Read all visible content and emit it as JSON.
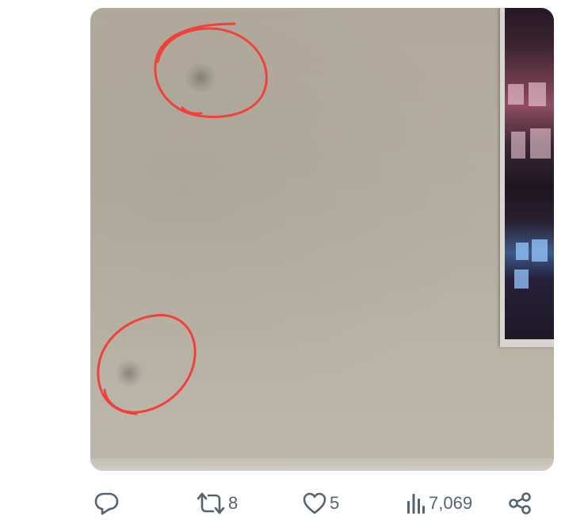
{
  "tweet": {
    "actions": {
      "reply": {
        "icon": "reply-icon"
      },
      "retweet": {
        "icon": "retweet-icon",
        "count": "8"
      },
      "like": {
        "icon": "heart-icon",
        "count": "5"
      },
      "views": {
        "icon": "views-bar-chart-icon",
        "count": "7,069"
      },
      "share": {
        "icon": "share-icon"
      }
    }
  },
  "colors": {
    "action_gray": "#536471",
    "annotation_red": "#f2403a"
  }
}
